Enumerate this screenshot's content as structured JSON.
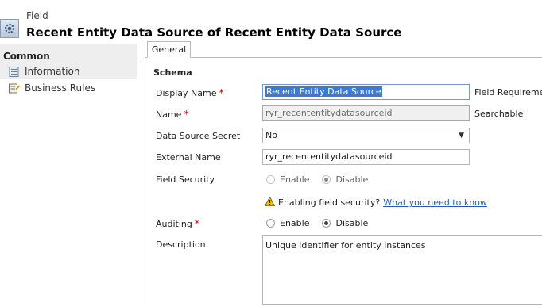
{
  "header": {
    "entity_label": "Field",
    "title": "Recent Entity Data Source of Recent Entity Data Source",
    "icon": "gear-icon"
  },
  "sidebar": {
    "heading": "Common",
    "items": [
      {
        "label": "Information",
        "icon": "form-icon"
      },
      {
        "label": "Business Rules",
        "icon": "rules-icon"
      }
    ]
  },
  "tabs": [
    {
      "label": "General",
      "active": true
    }
  ],
  "schema": {
    "title": "Schema",
    "display_name": {
      "label": "Display Name",
      "value": "Recent Entity Data Source",
      "required": "*",
      "side_label": "Field Requiremen"
    },
    "name": {
      "label": "Name",
      "value": "ryr_recententitydatasourceid",
      "required": "*",
      "side_label": "Searchable"
    },
    "data_source_secret": {
      "label": "Data Source Secret",
      "value": "No"
    },
    "external_name": {
      "label": "External Name",
      "value": "ryr_recententitydatasourceid"
    },
    "field_security": {
      "label": "Field Security",
      "options": [
        "Enable",
        "Disable"
      ],
      "selected": "Disable",
      "warning_text": "Enabling field security?",
      "warning_link": "What you need to know"
    },
    "auditing": {
      "label": "Auditing",
      "required": "*",
      "options": [
        "Enable",
        "Disable"
      ],
      "selected": "Disable"
    },
    "description": {
      "label": "Description",
      "value": "Unique identifier for entity instances"
    }
  },
  "colors": {
    "accent": "#3a7bd5",
    "required": "#c00000",
    "link": "#1f5fb3",
    "warning": "#f2c200"
  }
}
